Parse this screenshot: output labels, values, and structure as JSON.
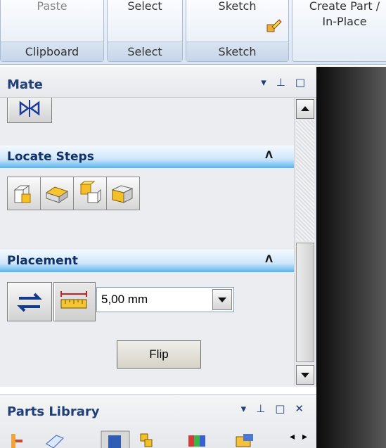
{
  "ribbon": {
    "groups": [
      {
        "button": "Paste",
        "caption": "Clipboard"
      },
      {
        "button": "Select",
        "caption": "Select"
      },
      {
        "button": "Sketch",
        "caption": "Sketch"
      },
      {
        "button_line1": "Create Part /",
        "button_line2": "In-Place"
      }
    ]
  },
  "mate": {
    "title": "Mate",
    "button_icon": "mate-flip-icon",
    "tools": {
      "dropdown": "▾",
      "pin": "⊥",
      "maximize": "□"
    }
  },
  "locate_steps": {
    "title": "Locate Steps",
    "collapse_icon": "double-chevron-up-icon",
    "buttons": [
      "locate-step-1-icon",
      "locate-step-2-icon",
      "locate-step-3-icon",
      "locate-step-4-icon"
    ]
  },
  "placement": {
    "title": "Placement",
    "collapse_icon": "double-chevron-up-icon",
    "offset_value": "5,00 mm",
    "flip_label": "Flip"
  },
  "parts_library": {
    "title": "Parts Library",
    "tools": {
      "dropdown": "▾",
      "pin": "⊥",
      "maximize": "□",
      "close": "✕"
    },
    "nav_prev": "◂",
    "nav_next": "▸"
  },
  "colors": {
    "header_text": "#1f3f7a",
    "section_gradient_bottom": "#58b4ee",
    "viewport": "#1a1a1a"
  }
}
